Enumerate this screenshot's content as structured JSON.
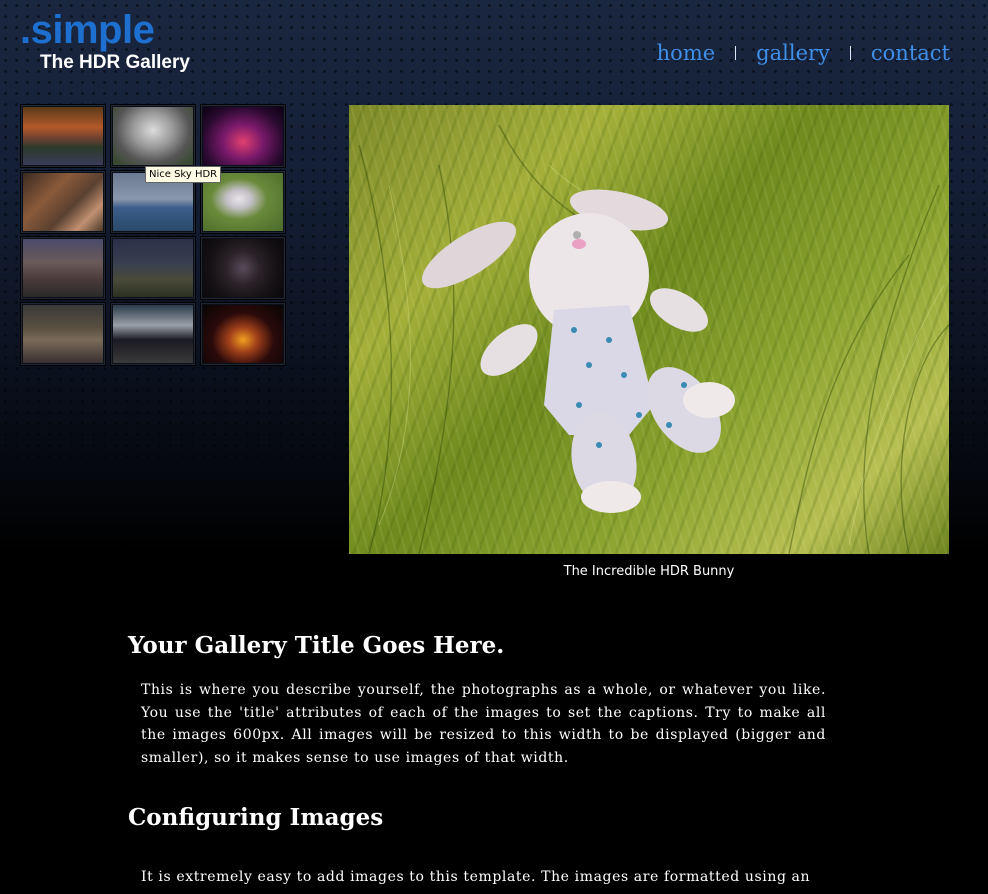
{
  "header": {
    "logo_main": ".simple",
    "logo_sub": "The HDR Gallery"
  },
  "nav": {
    "items": [
      {
        "label": "home"
      },
      {
        "label": "gallery"
      },
      {
        "label": "contact"
      }
    ]
  },
  "thumbnails": {
    "tooltip": "Nice Sky HDR"
  },
  "main": {
    "caption": "The Incredible HDR Bunny"
  },
  "content": {
    "title": "Your Gallery Title Goes Here.",
    "intro": "This is where you describe yourself, the photographs as a whole, or whatever you like. You use the 'title' attributes of each of the images to set the captions. Try to make all the images 600px. All images will be resized to this width to be displayed (bigger and smaller), so it makes sense to use images of that width.",
    "section_title": "Configuring Images",
    "section_text": "It is extremely easy to add images to this template. The images are formatted using an"
  },
  "colors": {
    "logo_blue": "#1d6fd0",
    "nav_blue": "#3f8fe8",
    "background_top": "#1a2740",
    "background_bottom": "#000000"
  }
}
